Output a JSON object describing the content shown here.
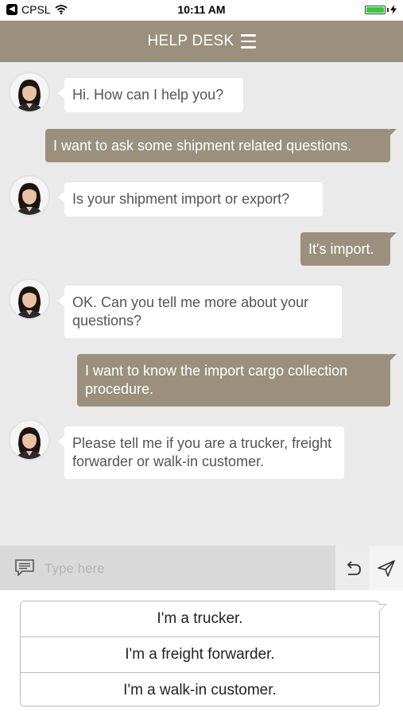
{
  "status_bar": {
    "carrier": "CPSL",
    "time": "10:11 AM",
    "battery_level": 1.0
  },
  "header": {
    "title": "HELP DESK",
    "menu_icon": "hamburger-menu-icon"
  },
  "messages": [
    {
      "sender": "bot",
      "text": "Hi. How can I help you?"
    },
    {
      "sender": "user",
      "text": "I want to ask some shipment related questions."
    },
    {
      "sender": "bot",
      "text": "Is your shipment import or export?"
    },
    {
      "sender": "user",
      "text": "It's import."
    },
    {
      "sender": "bot",
      "text": "OK. Can you tell me more about your questions?"
    },
    {
      "sender": "user",
      "text": "I want to know the import cargo collection procedure."
    },
    {
      "sender": "bot",
      "text": "Please tell me if you are a trucker, freight forwarder or walk-in customer."
    }
  ],
  "input": {
    "placeholder": "Type here",
    "value": ""
  },
  "quick_replies": [
    {
      "label": "I'm a trucker."
    },
    {
      "label": "I'm a freight forwarder."
    },
    {
      "label": "I'm a walk-in customer."
    }
  ],
  "colors": {
    "accent": "#9b907d",
    "chat_bg": "#eaeaea",
    "input_bg": "#d9d9d9"
  }
}
